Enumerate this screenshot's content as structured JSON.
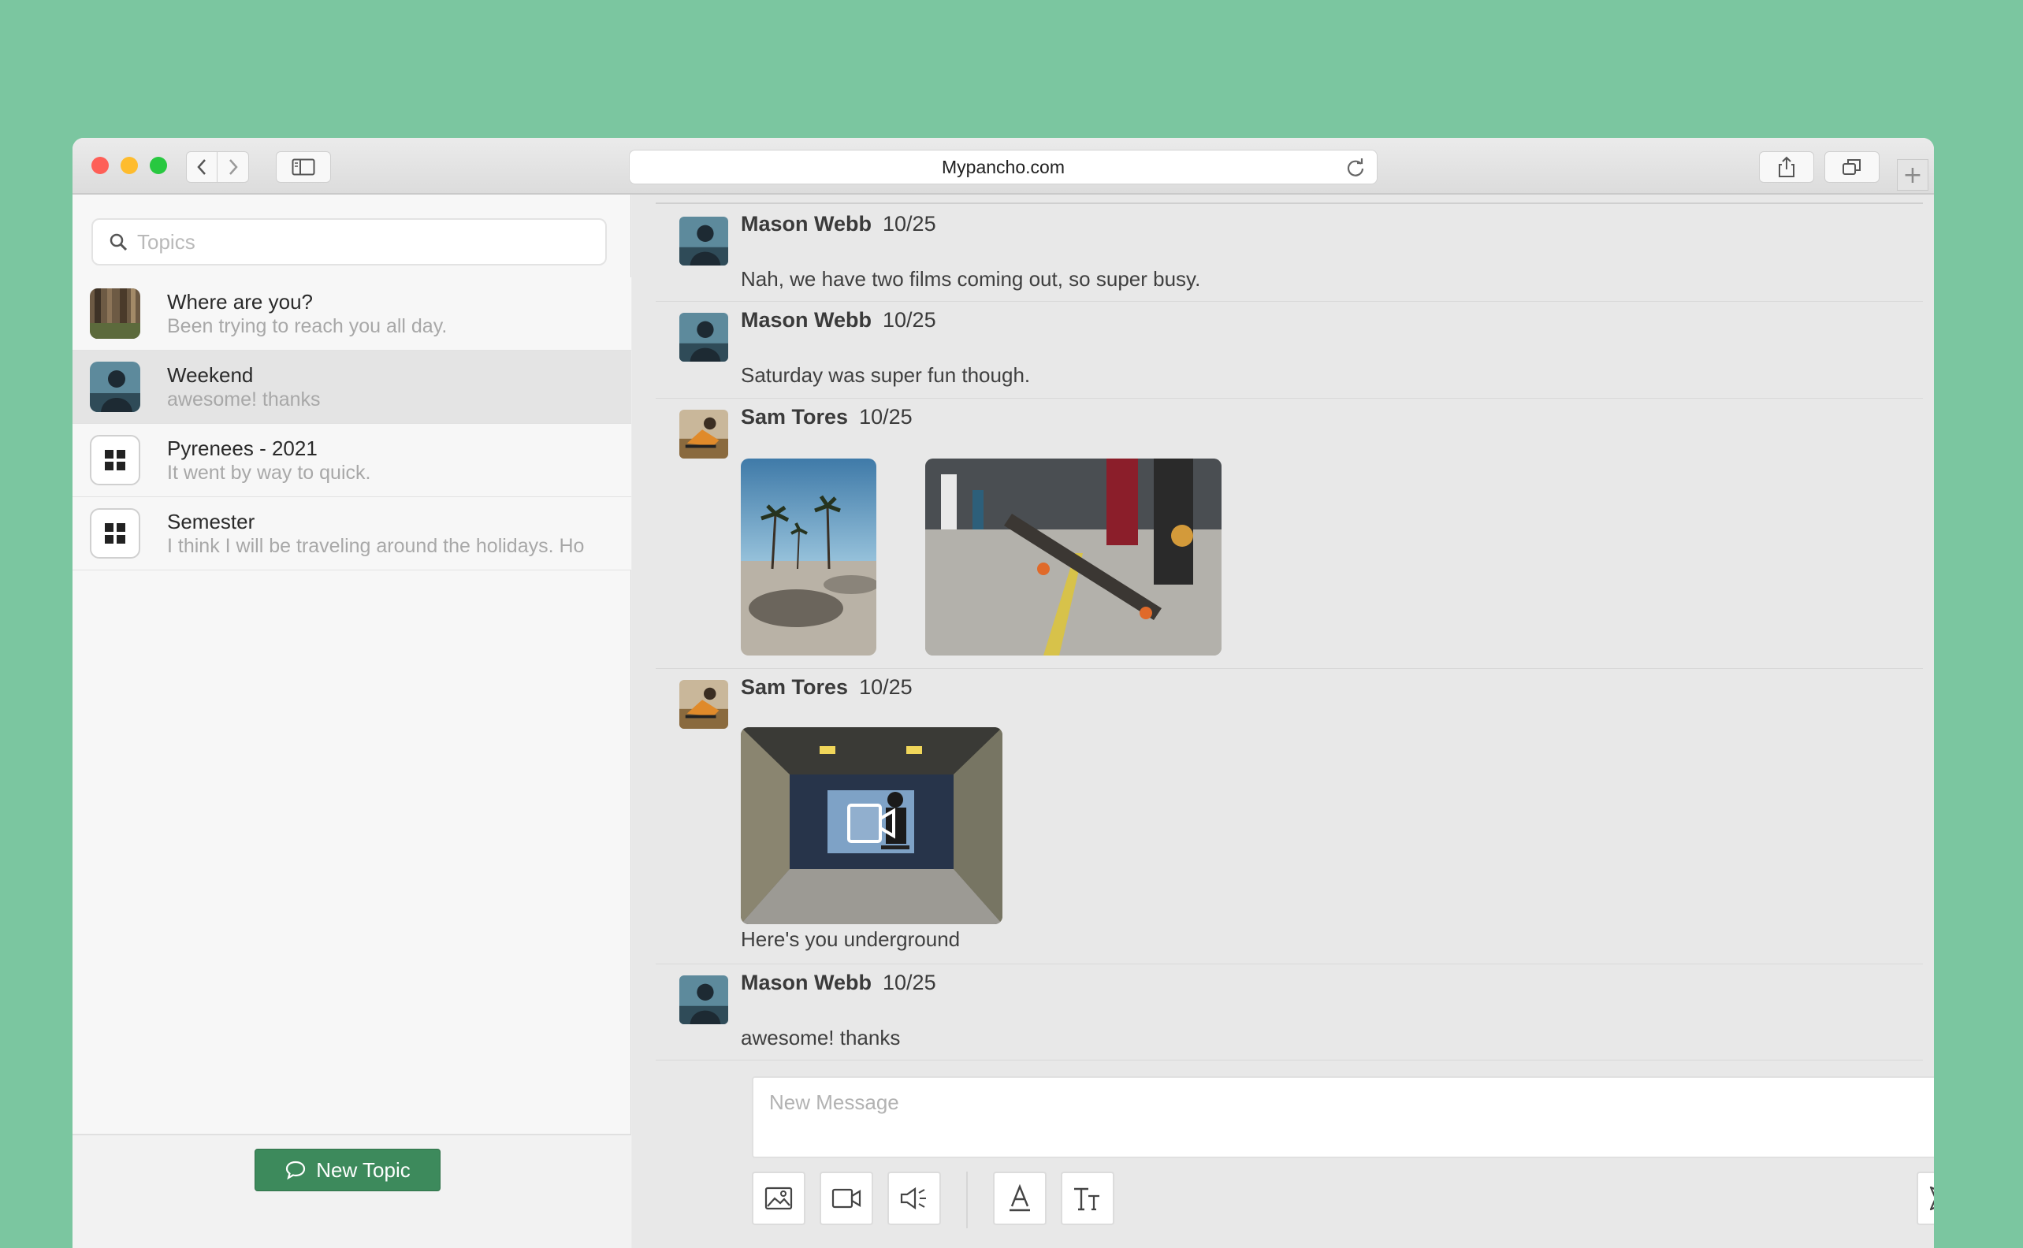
{
  "browser": {
    "url": "Mypancho.com",
    "new_tab_glyph": "+"
  },
  "sidebar": {
    "search_placeholder": "Topics",
    "topics": [
      {
        "title": "Where are you?",
        "preview": "Been trying to reach you all day.",
        "avatar": "forest-photo",
        "selected": false
      },
      {
        "title": "Weekend",
        "preview": "awesome! thanks",
        "avatar": "person-photo",
        "selected": true
      },
      {
        "title": "Pyrenees - 2021",
        "preview": "It went by way to quick.",
        "avatar": "grid-icon",
        "selected": false
      },
      {
        "title": "Semester",
        "preview": "I think I will be traveling around the holidays. Ho",
        "avatar": "grid-icon",
        "selected": false
      }
    ],
    "new_topic_label": "New Topic"
  },
  "messages": [
    {
      "author": "Mason Webb",
      "date": "10/25",
      "text": "Nah, we have two films coming out, so super busy."
    },
    {
      "author": "Mason Webb",
      "date": "10/25",
      "text": "Saturday was super fun though."
    },
    {
      "author": "Sam Tores",
      "date": "10/25",
      "attachments": [
        "palm-trees-skatepark-photo",
        "skateboard-trick-photo"
      ]
    },
    {
      "author": "Sam Tores",
      "date": "10/25",
      "attachments": [
        "underground-skater-video"
      ],
      "caption": "Here's you underground"
    },
    {
      "author": "Mason Webb",
      "date": "10/25",
      "text": "awesome! thanks"
    }
  ],
  "composer": {
    "placeholder": "New Message",
    "tools": [
      "image-icon",
      "video-icon",
      "audio-icon",
      "text-color-icon",
      "text-size-icon",
      "send-icon"
    ]
  },
  "colors": {
    "background": "#7bc6a0",
    "accent": "#3d8a5c",
    "selected_topic": "#e4e4e4"
  }
}
